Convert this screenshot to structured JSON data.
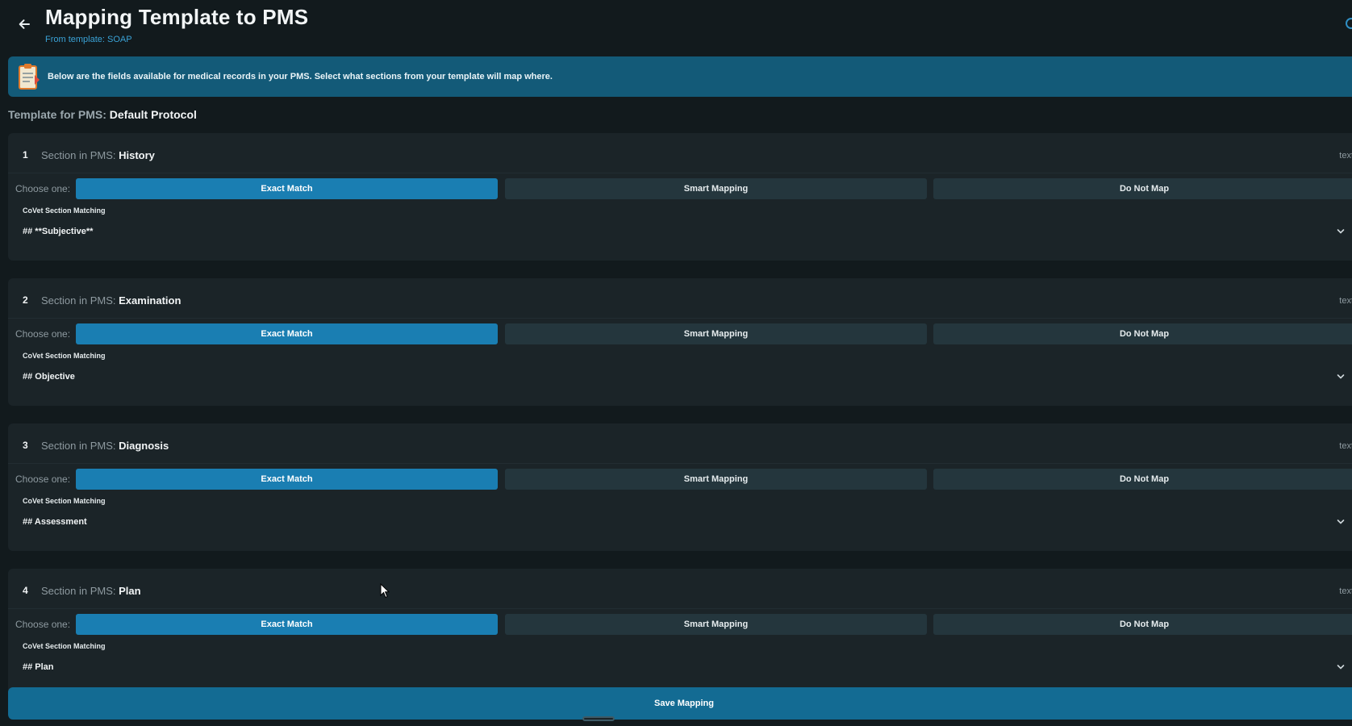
{
  "header": {
    "title": "Mapping Template to PMS",
    "subtitle": "From template: SOAP"
  },
  "banner": {
    "text": "Below are the fields available for medical records in your PMS. Select what sections from your template will map where."
  },
  "template": {
    "label": "Template for PMS:",
    "name": "Default Protocol"
  },
  "common": {
    "section_label": "Section in PMS:",
    "choose_label": "Choose one:",
    "options": [
      "Exact Match",
      "Smart Mapping",
      "Do Not Map"
    ],
    "match_caption": "CoVet Section Matching",
    "type_label": "text"
  },
  "sections": [
    {
      "num": "1",
      "name": "History",
      "selected_option": "Exact Match",
      "match_value": "## **Subjective**"
    },
    {
      "num": "2",
      "name": "Examination",
      "selected_option": "Exact Match",
      "match_value": "## Objective"
    },
    {
      "num": "3",
      "name": "Diagnosis",
      "selected_option": "Exact Match",
      "match_value": "## Assessment"
    },
    {
      "num": "4",
      "name": "Plan",
      "selected_option": "Exact Match",
      "match_value": "## Plan"
    }
  ],
  "save_button": {
    "label": "Save Mapping"
  },
  "colors": {
    "background": "#121a1d",
    "card": "#1b2428",
    "banner": "#135a78",
    "accent": "#1a7eb2",
    "subtitle": "#3aa2d6"
  },
  "icons": {
    "back": "arrow-left-icon",
    "banner": "clipboard-icon",
    "dropdown": "chevron-down-icon"
  }
}
